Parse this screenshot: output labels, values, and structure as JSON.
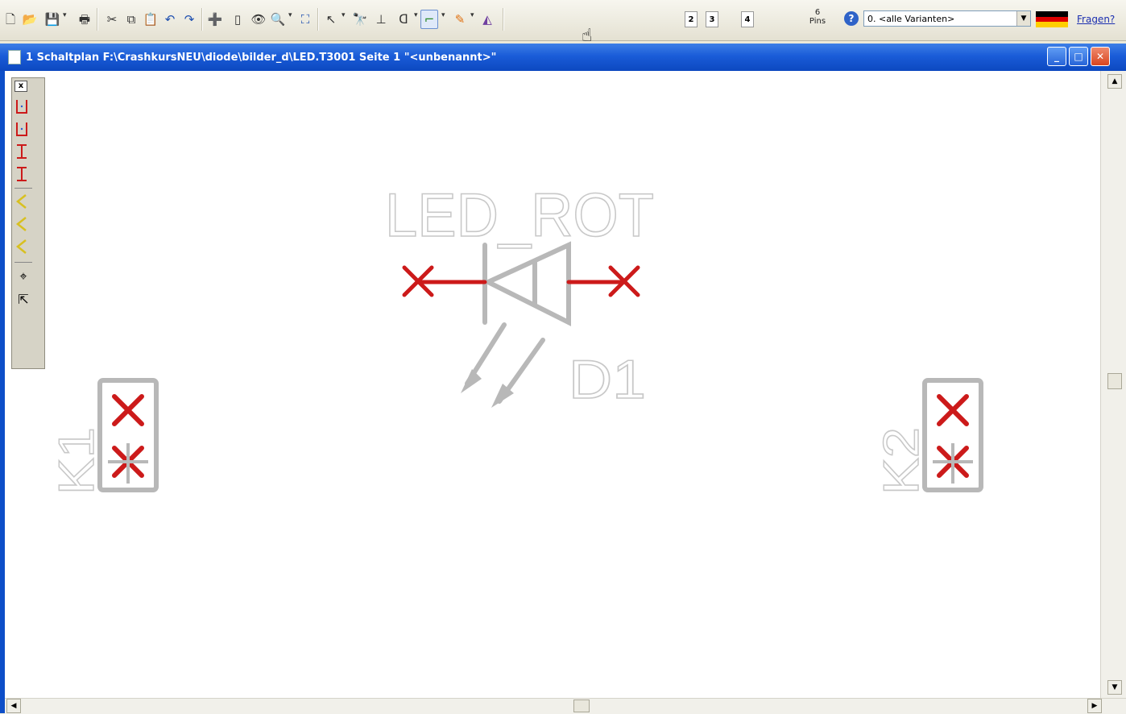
{
  "toolbar": {
    "icons": [
      "new-document-icon",
      "open-folder-icon",
      "save-icon",
      "print-icon",
      "cut-icon",
      "copy-icon",
      "paste-icon",
      "undo-icon",
      "redo-icon",
      "add-part-icon",
      "page-icon",
      "view-icon",
      "zoom-icon",
      "fit-icon",
      "select-icon",
      "find-icon",
      "pin-icon",
      "gate-icon",
      "wire-icon",
      "pencil-icon",
      "bus-icon"
    ],
    "pages": [
      "2",
      "3",
      "4"
    ],
    "pins_count": "6",
    "pins_label": "Pins",
    "variant": "0. <alle Varianten>",
    "help_link": "Fragen?",
    "flag_colors": [
      "#000000",
      "#dd0000",
      "#ffce00"
    ]
  },
  "window": {
    "title": "1 Schaltplan F:\\CrashkursNEU\\diode\\bilder_d\\LED.T3001 Seite 1 \"<unbenannt>\"",
    "minimize": "_",
    "maximize": "□",
    "close": "✕"
  },
  "palette": {
    "close": "x",
    "tools": [
      "wire-tool-icon",
      "wire-tool-icon",
      "wire-tool-icon",
      "wire-tool-icon",
      "angle-tool-icon",
      "angle-tool-icon",
      "angle-tool-icon",
      "cursor-plus-icon",
      "cursor-paint-icon"
    ]
  },
  "schematic": {
    "part_value": "LED_ROT",
    "part_name": "D1",
    "connector_left": "K1",
    "connector_right": "K2",
    "wire_color": "#cc1a1a",
    "part_color": "#b8b8b8",
    "label_color": "#c8c8c8"
  }
}
